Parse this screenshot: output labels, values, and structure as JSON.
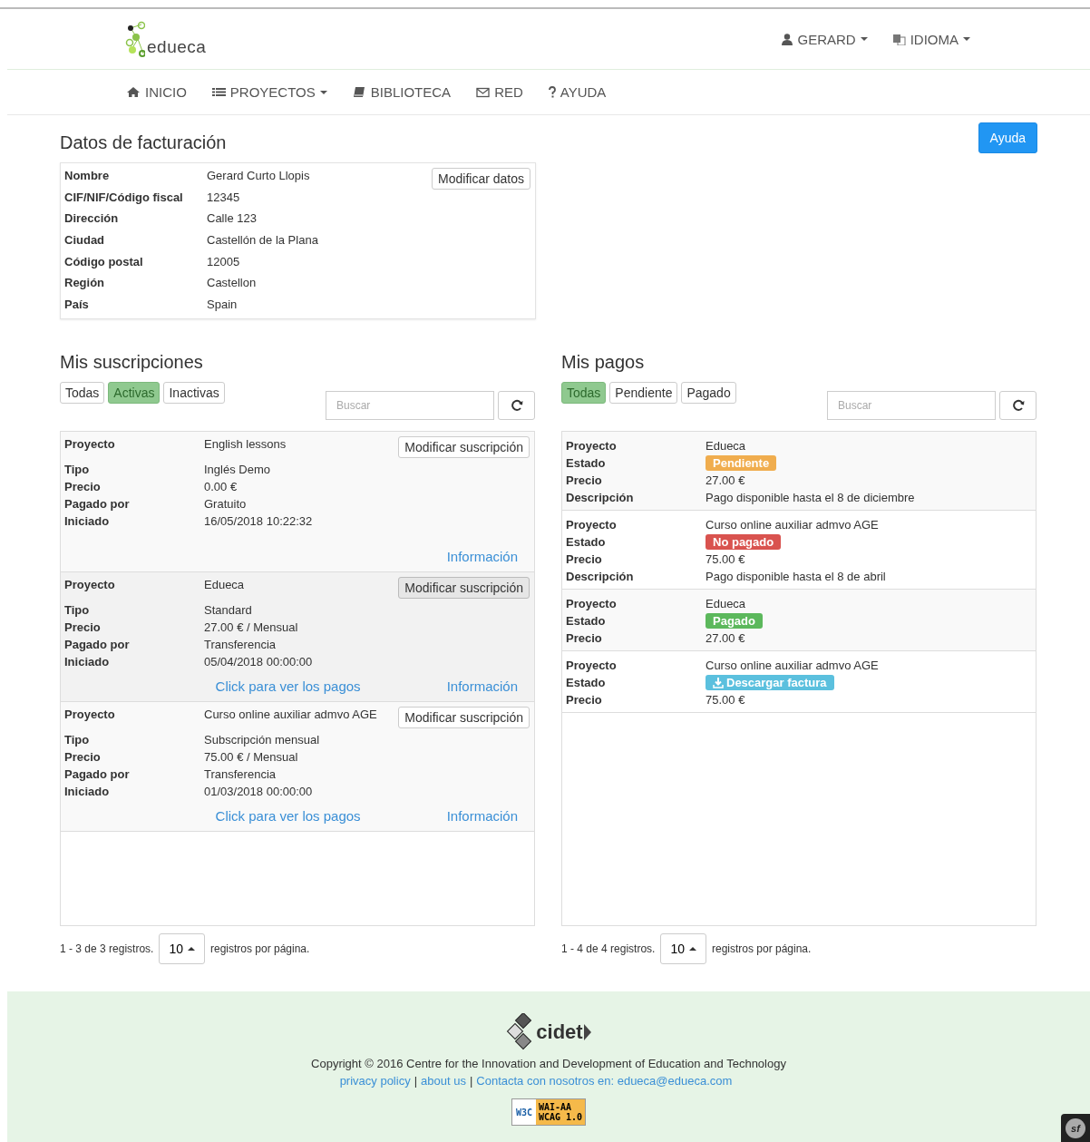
{
  "header": {
    "logo": "edueca",
    "user": "GERARD",
    "language": "IDIOMA"
  },
  "nav": [
    {
      "label": "INICIO",
      "dropdown": false
    },
    {
      "label": "PROYECTOS",
      "dropdown": true
    },
    {
      "label": "BIBLIOTECA",
      "dropdown": false
    },
    {
      "label": "RED",
      "dropdown": false
    },
    {
      "label": "AYUDA",
      "dropdown": false
    }
  ],
  "billing": {
    "title": "Datos de facturación",
    "help_button": "Ayuda",
    "modify_button": "Modificar datos",
    "rows": [
      {
        "label": "Nombre",
        "value": "Gerard Curto Llopis"
      },
      {
        "label": "CIF/NIF/Código fiscal",
        "value": "12345"
      },
      {
        "label": "Dirección",
        "value": "Calle 123"
      },
      {
        "label": "Ciudad",
        "value": "Castellón de la Plana"
      },
      {
        "label": "Código postal",
        "value": "12005"
      },
      {
        "label": "Región",
        "value": "Castellon"
      },
      {
        "label": "País",
        "value": "Spain"
      }
    ]
  },
  "subscriptions": {
    "title": "Mis suscripciones",
    "filters": [
      {
        "label": "Todas",
        "selected": false
      },
      {
        "label": "Activas",
        "selected": true
      },
      {
        "label": "Inactivas",
        "selected": false
      }
    ],
    "search": {
      "placeholder": "Buscar"
    },
    "items": [
      {
        "highlighted": false,
        "button": "Modificar suscripción",
        "fields": [
          {
            "label": "Proyecto",
            "value": "English lessons"
          },
          {
            "label": "Tipo",
            "value": "Inglés Demo"
          },
          {
            "label": "Precio",
            "value": "0.00 €"
          },
          {
            "label": "Pagado por",
            "value": "Gratuito"
          },
          {
            "label": "Iniciado",
            "value": "16/05/2018 10:22:32"
          }
        ],
        "info_link": "Información"
      },
      {
        "highlighted": true,
        "button": "Modificar suscripción",
        "fields": [
          {
            "label": "Proyecto",
            "value": "Edueca"
          },
          {
            "label": "Tipo",
            "value": "Standard"
          },
          {
            "label": "Precio",
            "value": "27.00 € / Mensual"
          },
          {
            "label": "Pagado por",
            "value": "Transferencia"
          },
          {
            "label": "Iniciado",
            "value": "05/04/2018 00:00:00"
          }
        ],
        "payments_link": "Click para ver los pagos",
        "info_link": "Información"
      },
      {
        "highlighted": false,
        "button": "Modificar suscripción",
        "fields": [
          {
            "label": "Proyecto",
            "value": "Curso online auxiliar admvo AGE"
          },
          {
            "label": "Tipo",
            "value": "Subscripción mensual"
          },
          {
            "label": "Precio",
            "value": "75.00 € / Mensual"
          },
          {
            "label": "Pagado por",
            "value": "Transferencia"
          },
          {
            "label": "Iniciado",
            "value": "01/03/2018 00:00:00"
          }
        ],
        "payments_link": "Click para ver los pagos",
        "info_link": "Información"
      }
    ],
    "pagination": {
      "summary": "1 - 3 de 3 registros.",
      "page_size": "10",
      "suffix": "registros por página."
    }
  },
  "payments": {
    "title": "Mis pagos",
    "filters": [
      {
        "label": "Todas",
        "selected": true
      },
      {
        "label": "Pendiente",
        "selected": false
      },
      {
        "label": "Pagado",
        "selected": false
      }
    ],
    "search": {
      "placeholder": "Buscar"
    },
    "items": [
      {
        "fields": [
          {
            "kind": "text",
            "label": "Proyecto",
            "value": "Edueca"
          },
          {
            "kind": "badge",
            "label": "Estado",
            "value": "Pendiente",
            "color": "#f0ad4e"
          },
          {
            "kind": "text",
            "label": "Precio",
            "value": "27.00 €"
          },
          {
            "kind": "text",
            "label": "Descripción",
            "value": "Pago disponible hasta el 8 de diciembre"
          }
        ]
      },
      {
        "fields": [
          {
            "kind": "text",
            "label": "Proyecto",
            "value": "Curso online auxiliar admvo AGE"
          },
          {
            "kind": "badge",
            "label": "Estado",
            "value": "No pagado",
            "color": "#d9534f"
          },
          {
            "kind": "text",
            "label": "Precio",
            "value": "75.00 €"
          },
          {
            "kind": "text",
            "label": "Descripción",
            "value": "Pago disponible hasta el 8 de abril"
          }
        ]
      },
      {
        "fields": [
          {
            "kind": "text",
            "label": "Proyecto",
            "value": "Edueca"
          },
          {
            "kind": "badge",
            "label": "Estado",
            "value": "Pagado",
            "color": "#5cb85c"
          },
          {
            "kind": "text",
            "label": "Precio",
            "value": "27.00 €"
          }
        ]
      },
      {
        "fields": [
          {
            "kind": "text",
            "label": "Proyecto",
            "value": "Curso online auxiliar admvo AGE"
          },
          {
            "kind": "download",
            "label": "Estado",
            "value": "Descargar factura",
            "color": "#5bc0de"
          },
          {
            "kind": "text",
            "label": "Precio",
            "value": "75.00 €"
          }
        ]
      }
    ],
    "pagination": {
      "summary": "1 - 4 de 4 registros.",
      "page_size": "10",
      "suffix": "registros por página."
    }
  },
  "footer": {
    "logo": "cidet",
    "copyright": "Copyright © 2016 Centre for the Innovation and Development of Education and Technology",
    "links": [
      "privacy policy",
      "about us",
      "Contacta con nosotros en: edueca@edueca.com"
    ],
    "separator": "|",
    "badge": {
      "w3c": "W3C",
      "level": "WAI-AA",
      "version": "WCAG 1.0"
    }
  },
  "debug_toolbar": {
    "label": "sf"
  }
}
